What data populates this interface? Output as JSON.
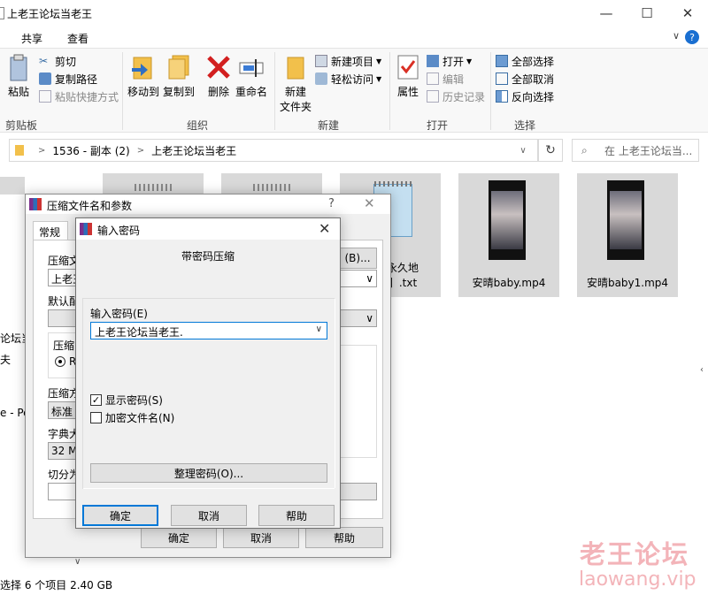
{
  "window": {
    "title": "上老王论坛当老王",
    "minimize": "—",
    "maximize": "☐",
    "close": "✕"
  },
  "menubar": {
    "tabs": [
      "共享",
      "查看"
    ],
    "collapse": "∨",
    "help": "?"
  },
  "ribbon": {
    "clipboard": {
      "paste": "粘贴",
      "cut": "剪切",
      "copy_path": "复制路径",
      "paste_shortcut": "粘贴快捷方式",
      "group": "剪贴板"
    },
    "organize": {
      "move_to": "移动到",
      "copy_to": "复制到",
      "delete": "删除",
      "rename": "重命名",
      "group": "组织"
    },
    "new": {
      "new_folder_line1": "新建",
      "new_folder_line2": "文件夹",
      "new_item": "新建项目",
      "easy_access": "轻松访问",
      "group": "新建"
    },
    "open": {
      "properties": "属性",
      "open": "打开",
      "edit": "编辑",
      "history": "历史记录",
      "group": "打开"
    },
    "select": {
      "select_all": "全部选择",
      "select_none": "全部取消",
      "invert": "反向选择",
      "group": "选择"
    }
  },
  "address": {
    "path_parts": [
      "1536 - 副本 (2)",
      "上老王论坛当老王"
    ],
    "search_placeholder": "在 上老王论坛当..."
  },
  "navpane": {
    "items": [
      "论坛当",
      "夫",
      "e - Per"
    ]
  },
  "files": [
    {
      "name": "坛永久地\n页】.txt",
      "kind": "text"
    },
    {
      "name": "安晴baby.mp4",
      "kind": "video"
    },
    {
      "name": "安晴baby1.mp4",
      "kind": "video"
    }
  ],
  "status": {
    "text": "选择 6 个项目  2.40 GB"
  },
  "watermark": {
    "line1": "老王论坛",
    "line2": "laowang.vip"
  },
  "archive_dialog": {
    "title": "压缩文件名和参数",
    "help": "?",
    "tab": "常规",
    "archive_name_label": "压缩文",
    "archive_name_value": "上老王",
    "browse": "(B)...",
    "profile_label": "默认配",
    "format_label": "压缩",
    "format_radio": "RA",
    "method_label": "压缩方",
    "method_value": "标准",
    "dict_label": "字典大",
    "dict_value": "32 MB",
    "split_label": "切分为",
    "ok": "确定",
    "cancel": "取消",
    "help_btn": "帮助"
  },
  "password_dialog": {
    "title": "输入密码",
    "heading": "带密码压缩",
    "password_label": "输入密码(E)",
    "password_value": "上老王论坛当老王.",
    "show_password": "显示密码(S)",
    "show_password_checked": true,
    "encrypt_names": "加密文件名(N)",
    "encrypt_names_checked": false,
    "organize": "整理密码(O)...",
    "ok": "确定",
    "cancel": "取消",
    "help": "帮助"
  }
}
